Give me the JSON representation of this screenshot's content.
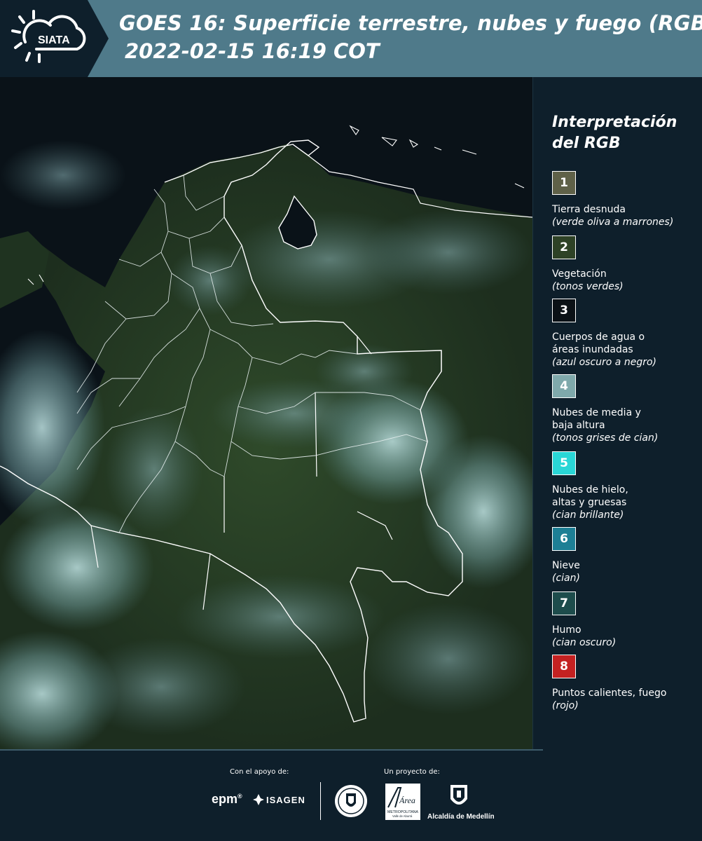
{
  "header": {
    "logo_text": "SIATA",
    "title_line1": "GOES 16: Superficie terrestre, nubes y fuego (RGB)",
    "title_line2": "2022-02-15 16:19 COT",
    "band_color": "#4f7a8a"
  },
  "map": {
    "description_icon": "satellite-rgb-map",
    "boundary_color": "#ffffff"
  },
  "legend": {
    "title_line1": "Interpretación",
    "title_line2": "del RGB",
    "items": [
      {
        "number": "1",
        "color": "#5f6148",
        "label_lines": [
          "Tierra desnuda"
        ],
        "sub": "(verde oliva a marrones)"
      },
      {
        "number": "2",
        "color": "#2e4226",
        "label_lines": [
          "Vegetación"
        ],
        "sub": "(tonos verdes)"
      },
      {
        "number": "3",
        "color": "#0b1116",
        "label_lines": [
          "Cuerpos de agua o",
          "áreas inundadas"
        ],
        "sub": "(azul oscuro a negro)"
      },
      {
        "number": "4",
        "color": "#7fa9ab",
        "label_lines": [
          "Nubes de media y",
          "baja altura"
        ],
        "sub": "(tonos grises de cian)"
      },
      {
        "number": "5",
        "color": "#29d6d6",
        "label_lines": [
          "Nubes de hielo,",
          "altas y gruesas"
        ],
        "sub": "(cian brillante)"
      },
      {
        "number": "6",
        "color": "#1d7f95",
        "label_lines": [
          "Nieve"
        ],
        "sub": "(cian)"
      },
      {
        "number": "7",
        "color": "#1d4c4c",
        "label_lines": [
          "Humo"
        ],
        "sub": "(cian oscuro)"
      },
      {
        "number": "8",
        "color": "#c42121",
        "label_lines": [
          "Puntos calientes, fuego"
        ],
        "sub": "(rojo)"
      }
    ]
  },
  "footer": {
    "support_label": "Con el apoyo de:",
    "project_label": "Un proyecto de:",
    "epm": "epm",
    "epm_mark": "®",
    "isagen": "ISAGEN",
    "area_text": "Área",
    "area_sub": "METROPOLITANA",
    "area_sub2": "Valle de Aburrá",
    "alcaldia": "Alcaldía de Medellín"
  }
}
